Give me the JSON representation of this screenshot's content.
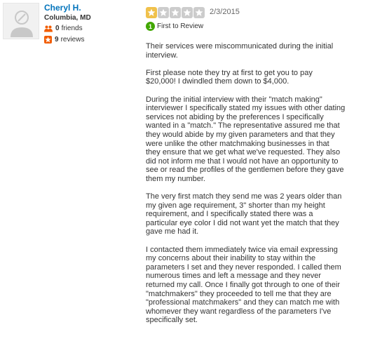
{
  "user": {
    "name": "Cheryl H.",
    "location": "Columbia, MD",
    "friends": {
      "count": "0",
      "label": "friends",
      "icon": "friends-icon"
    },
    "reviews": {
      "count": "9",
      "label": "reviews",
      "icon": "reviews-star-icon"
    }
  },
  "review": {
    "rating": 1,
    "rating_max": 5,
    "date": "2/3/2015",
    "badge_icon": "first-to-review-icon",
    "badge_number": "1",
    "badge_label": "First to Review",
    "paragraphs": [
      "Their services were miscommunicated during the initial\ninterview.",
      "First please note they try at first to get you to pay\n$20,000!  I dwindled them down to $4,000.",
      "During the initial interview with their \"match making\"\ninterviewer I specifically stated my issues with other dating\nservices not abiding by the preferences I specifically\nwanted in a \"match.\" The representative assured me that\nthey would abide by my given parameters and that they\nwere unlike the other matchmaking businesses in that\nthey ensure that we get what we've requested. They also\ndid not inform me that I would not have an opportunity to\nsee or read the profiles of the gentlemen before they gave\nthem my number.",
      "The very first match they send me was 2 years older than\nmy given age requirement, 3\" shorter than my height\nrequirement, and I specifically stated there was a\nparticular eye color I did not want yet the match that they\ngave me had it.",
      "I contacted them immediately twice via email expressing\nmy concerns about their inability to stay within the\nparameters I set and they never responded. I called them\nnumerous times and left a message and they never\nreturned my call. Once I finally got through to one of their\n\"matchmakers\" they proceeded to tell me that they are\n\"professional matchmakers\" and they can match me with\nwhomever they want regardless of the parameters I've\nspecifically set."
    ]
  },
  "colors": {
    "link": "#0073bb",
    "star_on": "#f0c14b",
    "star_off": "#cccccc",
    "badge": "#41a700",
    "reviews_icon": "#f15c00"
  }
}
